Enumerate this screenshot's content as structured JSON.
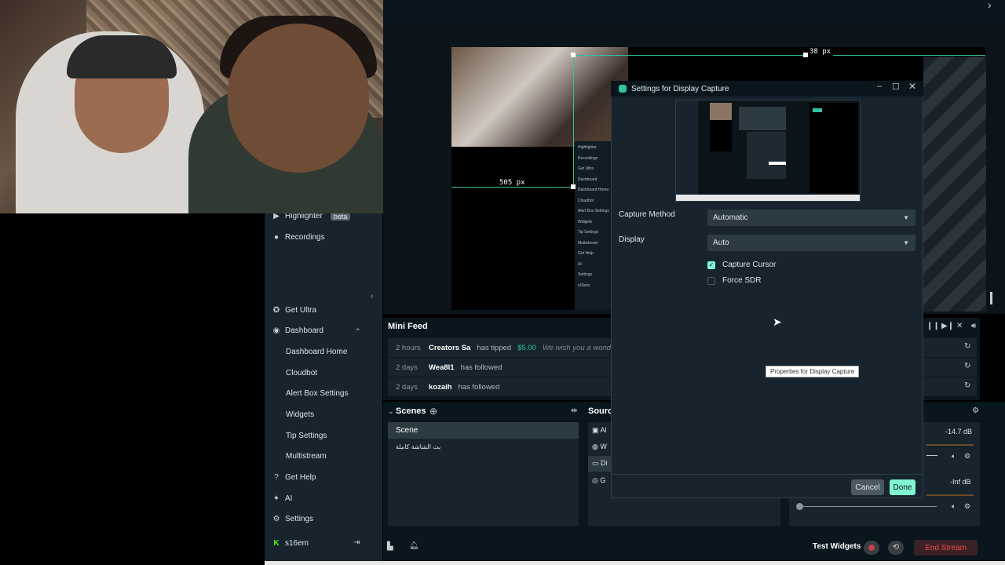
{
  "sidebar": {
    "highlighter": "Highlighter",
    "highlighter_badge": "beta",
    "recordings": "Recordings",
    "get_ultra": "Get Ultra",
    "dashboard": "Dashboard",
    "dashboard_items": [
      "Dashboard Home",
      "Cloudbot",
      "Alert Box Settings",
      "Widgets",
      "Tip Settings",
      "Multistream"
    ],
    "get_help": "Get Help",
    "ai": "AI",
    "settings": "Settings",
    "user": "s16em"
  },
  "editor": {
    "width_label": "505 px",
    "top_label": "38 px",
    "mini_list": [
      "Highlighter",
      "Recordings",
      "Get Ultra",
      "Dashboard",
      "Dashboard Home",
      "Cloudbot",
      "Alert Box Settings",
      "Widgets",
      "Tip Settings",
      "Multistream",
      "Get Help",
      "AI",
      "Settings",
      "s16em"
    ]
  },
  "minifeed": {
    "title": "Mini Feed",
    "rows": [
      {
        "time": "2 hours",
        "name": "Creators Sa",
        "action": "has tipped",
        "amount": "$5.00",
        "message": "We wish you a wonderful"
      },
      {
        "time": "2 days",
        "name": "Wea8l1",
        "action": "has followed"
      },
      {
        "time": "2 days",
        "name": "kozaih",
        "action": "has followed"
      }
    ]
  },
  "scenes": {
    "title": "Scenes",
    "items": [
      "Scene",
      "بث الشاشة كاملة"
    ]
  },
  "sources": {
    "title": "Sourc",
    "items": [
      "Al",
      "W",
      "Di",
      "G"
    ]
  },
  "mixer": {
    "db1": "-14.7 dB",
    "db2": "-Inf dB"
  },
  "bottom": {
    "test_widgets": "Test Widgets",
    "end_stream": "End Stream"
  },
  "modal": {
    "title": "Settings for Display Capture",
    "capture_method_label": "Capture Method",
    "capture_method_value": "Automatic",
    "display_label": "Display",
    "display_value": "Auto",
    "capture_cursor": "Capture Cursor",
    "capture_cursor_checked": true,
    "force_sdr": "Force SDR",
    "force_sdr_checked": false,
    "tooltip": "Properties for Display Capture",
    "cancel": "Cancel",
    "done": "Done"
  },
  "colors": {
    "accent": "#31c3a2",
    "done_button": "#80f5d2",
    "end_stream": "#f04a4a",
    "panel": "#17242d",
    "background": "#09161d"
  },
  "icons": [
    "camera-icon",
    "record-icon",
    "ultra-icon",
    "dashboard-icon",
    "chevron-up-icon",
    "help-icon",
    "ai-icon",
    "gear-icon",
    "logout-icon",
    "collapse-icon",
    "refresh-icon",
    "add-icon",
    "close-icon",
    "minimize-icon",
    "maximize-icon",
    "chevron-down-icon",
    "check-icon",
    "speaker-icon",
    "mute-icon",
    "bell-icon",
    "stats-icon",
    "cursor-icon"
  ]
}
